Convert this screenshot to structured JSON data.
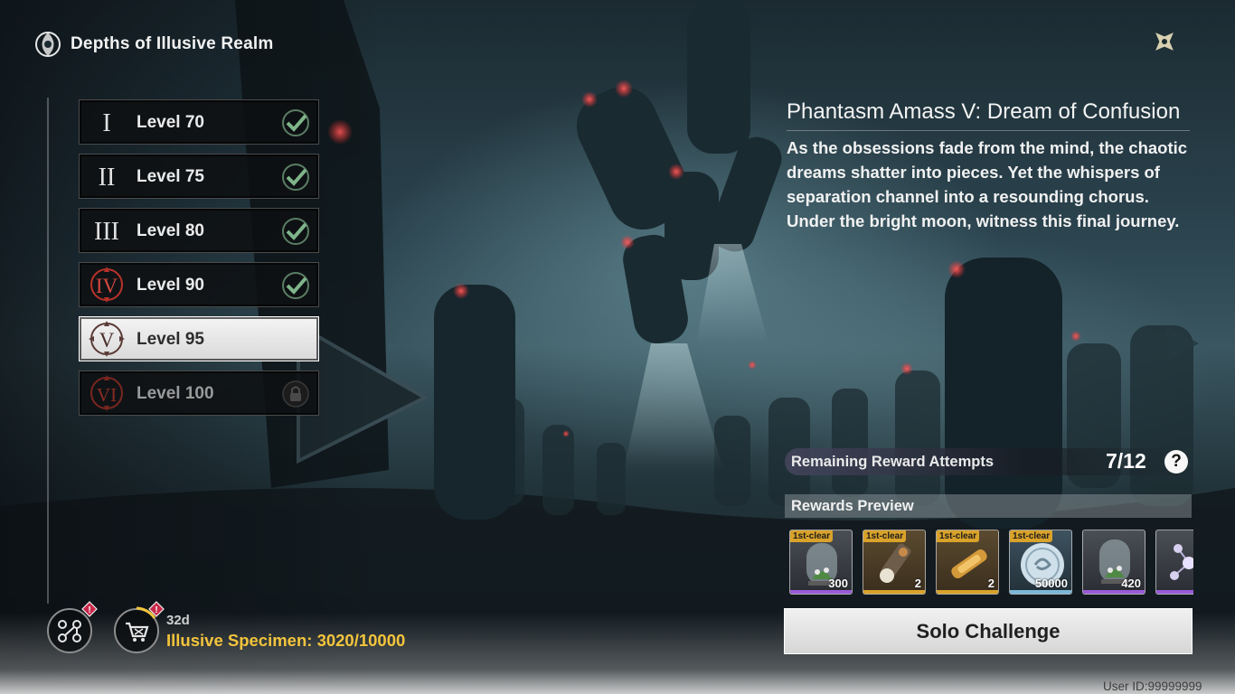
{
  "header": {
    "title": "Depths of Illusive Realm"
  },
  "levels": [
    {
      "numeral": "I",
      "label": "Level 70",
      "state": "cleared"
    },
    {
      "numeral": "II",
      "label": "Level 75",
      "state": "cleared"
    },
    {
      "numeral": "III",
      "label": "Level 80",
      "state": "cleared"
    },
    {
      "numeral": "IV",
      "label": "Level 90",
      "state": "cleared"
    },
    {
      "numeral": "V",
      "label": "Level 95",
      "state": "selected"
    },
    {
      "numeral": "VI",
      "label": "Level 100",
      "state": "locked"
    }
  ],
  "stage": {
    "title": "Phantasm Amass V: Dream of Confusion",
    "description": "As the obsessions fade from the mind, the chaotic dreams shatter into pieces. Yet the whispers of separation channel into a resounding chorus. Under the bright moon, witness this final journey."
  },
  "attempts": {
    "label": "Remaining Reward Attempts",
    "value": "7/12",
    "help": "?"
  },
  "rewards": {
    "header": "Rewards Preview",
    "items": [
      {
        "tag": "1st-clear",
        "qty": "300",
        "icon": "glass-dome-plant-icon",
        "rarity_color": "#9a5ad8"
      },
      {
        "tag": "1st-clear",
        "qty": "2",
        "icon": "tuning-device-icon",
        "rarity_color": "#d9a22a"
      },
      {
        "tag": "1st-clear",
        "qty": "2",
        "icon": "amber-vial-icon",
        "rarity_color": "#d9a22a"
      },
      {
        "tag": "1st-clear",
        "qty": "50000",
        "icon": "shell-credit-coin-icon",
        "rarity_color": "#7bb8d8"
      },
      {
        "tag": "",
        "qty": "420",
        "icon": "glass-dome-plant-icon",
        "rarity_color": "#9a5ad8"
      },
      {
        "tag": "",
        "qty": "",
        "icon": "molecule-crystal-icon",
        "rarity_color": "#9a5ad8"
      }
    ]
  },
  "solo_button": {
    "label": "Solo Challenge"
  },
  "shop": {
    "timer": "32d",
    "currency": "Illusive Specimen: 3020/10000"
  },
  "alert_badge": "!",
  "user_id": "User ID:99999999",
  "colors": {
    "accent_gold": "#f3c43c",
    "check_green": "#7fb58a",
    "numeral_red": "#c0392b"
  }
}
